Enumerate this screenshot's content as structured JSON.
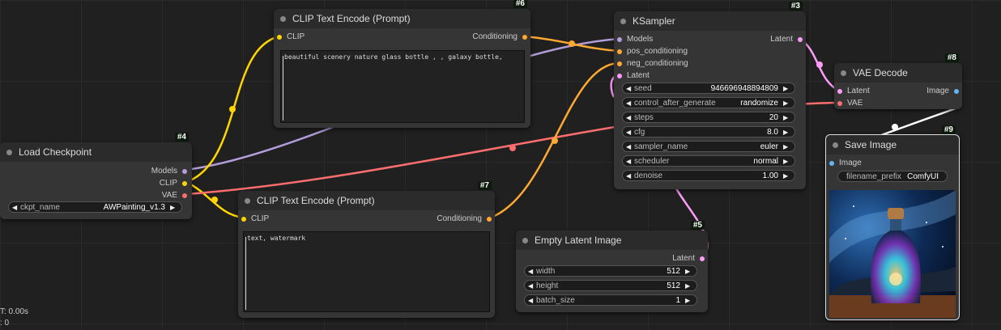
{
  "nodes": {
    "checkpoint": {
      "id": "#4",
      "title": "Load Checkpoint",
      "outputs": [
        "Models",
        "CLIP",
        "VAE"
      ],
      "widget": {
        "name": "ckpt_name",
        "value": "AWPainting_v1.3"
      }
    },
    "clip_pos": {
      "id": "#6",
      "title": "CLIP Text Encode (Prompt)",
      "input": "CLIP",
      "output": "Conditioning",
      "text": "beautiful scenery nature glass bottle , , galaxy bottle,"
    },
    "clip_neg": {
      "id": "#7",
      "title": "CLIP Text Encode (Prompt)",
      "input": "CLIP",
      "output": "Conditioning",
      "text": "text, watermark"
    },
    "ksampler": {
      "id": "#3",
      "title": "KSampler",
      "inputs": [
        "Models",
        "pos_conditioning",
        "neg_conditioning",
        "Latent"
      ],
      "output": "Latent",
      "widgets": [
        {
          "name": "seed",
          "value": "946696948894809"
        },
        {
          "name": "control_after_generate",
          "value": "randomize"
        },
        {
          "name": "steps",
          "value": "20"
        },
        {
          "name": "cfg",
          "value": "8.0"
        },
        {
          "name": "sampler_name",
          "value": "euler"
        },
        {
          "name": "scheduler",
          "value": "normal"
        },
        {
          "name": "denoise",
          "value": "1.00"
        }
      ]
    },
    "vae_decode": {
      "id": "#8",
      "title": "VAE Decode",
      "inputs": [
        "Latent",
        "VAE"
      ],
      "output": "Image"
    },
    "save_image": {
      "id": "#9",
      "title": "Save Image",
      "input": "Image",
      "widget": {
        "name": "filename_prefix",
        "value": "ComfyUI"
      }
    },
    "empty_latent": {
      "id": "#5",
      "title": "Empty Latent Image",
      "output": "Latent",
      "widgets": [
        {
          "name": "width",
          "value": "512"
        },
        {
          "name": "height",
          "value": "512"
        },
        {
          "name": "batch_size",
          "value": "1"
        }
      ]
    }
  },
  "status": {
    "line1": "T: 0.00s",
    "line2": ": 0"
  },
  "colors": {
    "model": "#b39ddb",
    "clip": "#ffd500",
    "vae": "#ff6e6e",
    "conditioning": "#ffa931",
    "latent": "#ff9cf9",
    "image": "#64b5f6"
  }
}
